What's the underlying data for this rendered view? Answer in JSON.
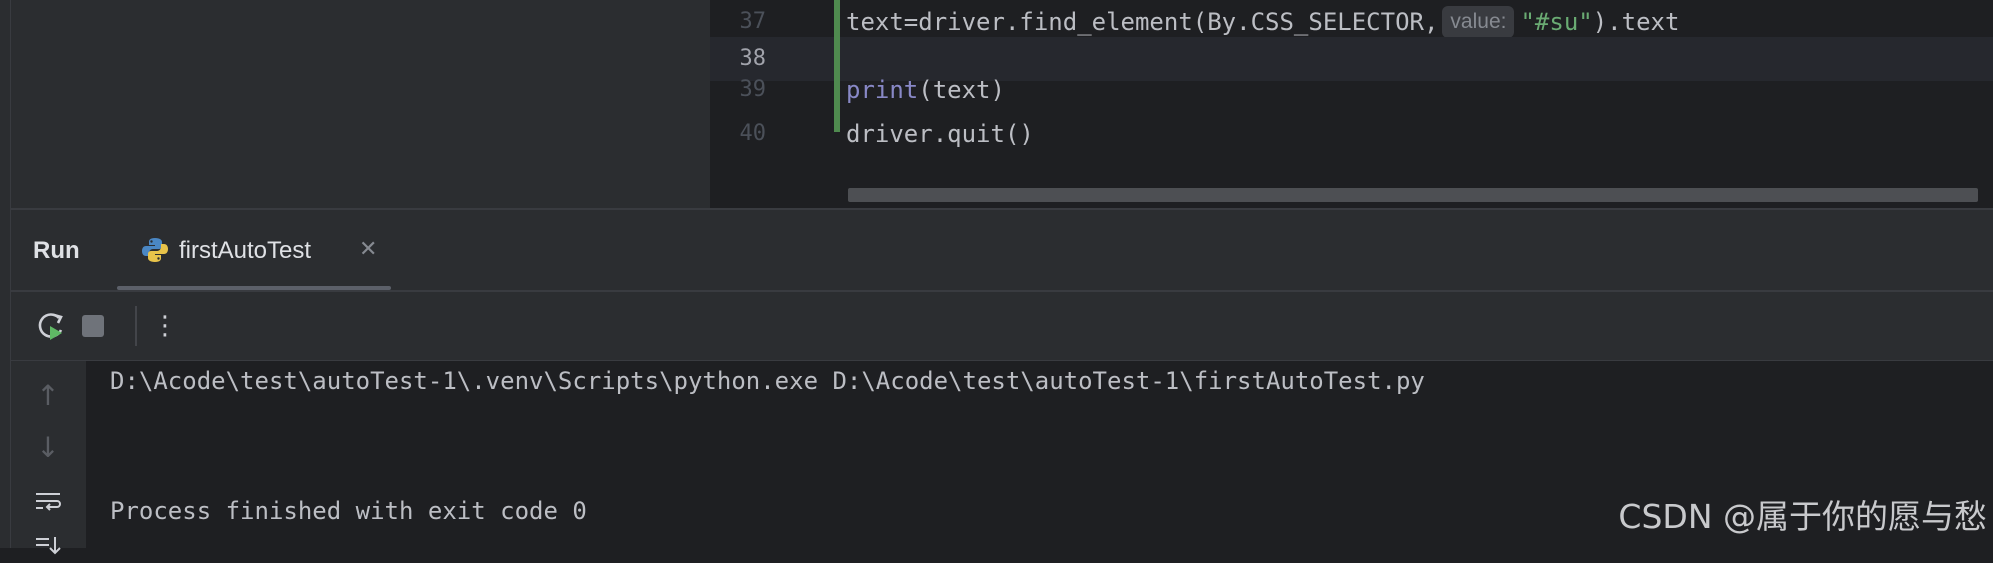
{
  "editor": {
    "lines": [
      {
        "number": "37",
        "code_prefix": "text=driver.find_element(By.CSS_SELECTOR,",
        "hint": "value:",
        "string": "\"#su\"",
        "code_suffix": ").text"
      },
      {
        "number": "38",
        "code": ""
      },
      {
        "number": "39",
        "keyword": "print",
        "code_suffix": "(text)"
      },
      {
        "number": "40",
        "code": "driver.quit()"
      }
    ]
  },
  "run_panel": {
    "title": "Run",
    "tab": {
      "label": "firstAutoTest",
      "icon": "python-icon",
      "close": "✕"
    }
  },
  "toolbar": {
    "rerun_icon": "rerun-icon",
    "stop_icon": "stop-icon",
    "more_glyph": "⋮"
  },
  "console": {
    "lines": [
      "D:\\Acode\\test\\autoTest-1\\.venv\\Scripts\\python.exe D:\\Acode\\test\\autoTest-1\\firstAutoTest.py",
      "Process finished with exit code 0"
    ]
  },
  "side_icons": {
    "up": "↑",
    "down": "↓"
  },
  "watermark": "CSDN @属于你的愿与愁",
  "colors": {
    "background": "#1e1f22",
    "panel": "#2b2d30",
    "keyword": "#8888c6",
    "string": "#6aab73",
    "change_marker": "#4f8a4f"
  }
}
